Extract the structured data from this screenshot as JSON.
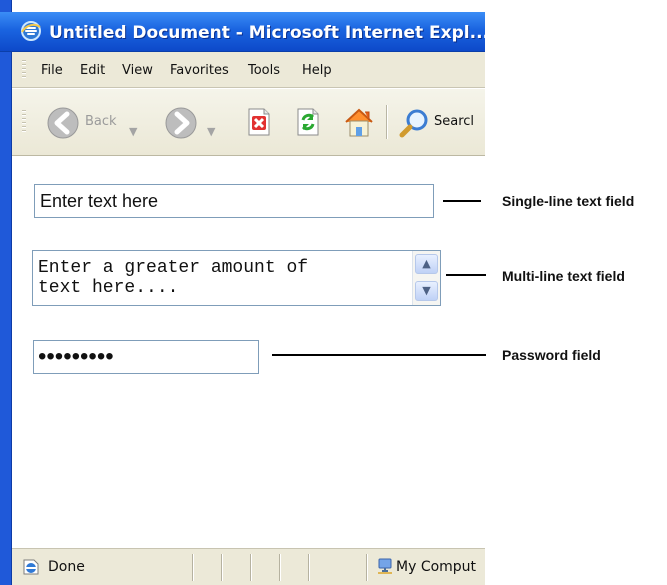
{
  "window": {
    "title": "Untitled Document - Microsoft Internet Expl..."
  },
  "menu": {
    "items": [
      {
        "label": "File"
      },
      {
        "label": "Edit"
      },
      {
        "label": "View"
      },
      {
        "label": "Favorites"
      },
      {
        "label": "Tools"
      },
      {
        "label": "Help"
      }
    ]
  },
  "toolbar": {
    "back_label": "Back",
    "search_label": "Searcl",
    "icons": {
      "back": "back-arrow-icon",
      "forward": "forward-arrow-icon",
      "stop": "stop-icon",
      "refresh": "refresh-icon",
      "home": "home-icon",
      "search": "search-icon"
    }
  },
  "form": {
    "single_line_value": "Enter text here",
    "multi_line_value": "Enter a greater amount of\ntext here....",
    "password_value": "•••••••••"
  },
  "labels": {
    "single_line": "Single-line text field",
    "multi_line": "Multi-line text field",
    "password": "Password field"
  },
  "status": {
    "left_text": "Done",
    "zone_text": "My Comput"
  },
  "colors": {
    "window_blue": "#1f59d9",
    "chrome_gray": "#ece9d8",
    "field_border": "#7f9db9"
  }
}
